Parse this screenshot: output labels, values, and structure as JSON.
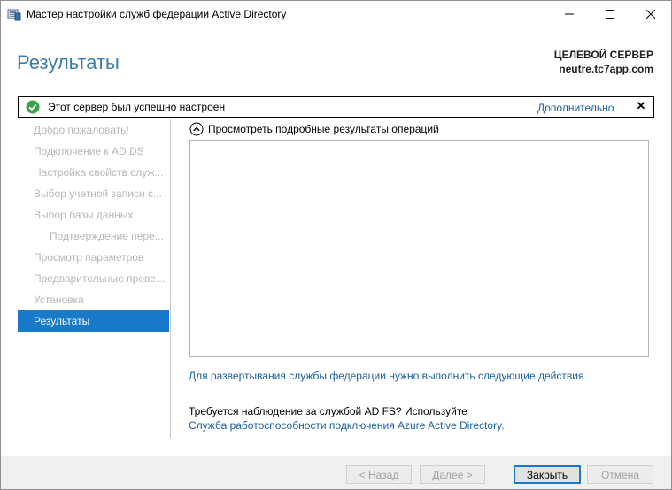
{
  "window": {
    "title": "Мастер настройки служб федерации Active Directory",
    "controls": {
      "minimize_icon": "minimize-icon",
      "maximize_icon": "maximize-icon",
      "close_icon": "close-icon"
    }
  },
  "header": {
    "page_title": "Результаты",
    "target_label": "ЦЕЛЕВОЙ СЕРВЕР",
    "target_name": "neutre.tc7app.com"
  },
  "notification": {
    "text": "Этот сервер был успешно настроен",
    "more_link": "Дополнительно",
    "close_glyph": "✕",
    "status_color": "#3aa14a"
  },
  "sidebar": {
    "items": [
      {
        "label": "Добро пожаловать!"
      },
      {
        "label": "Подключение к AD DS"
      },
      {
        "label": "Настройка свойств служ..."
      },
      {
        "label": "Выбор учетной записи с..."
      },
      {
        "label": "Выбор базы данных"
      },
      {
        "label": "Подтверждение пере..."
      },
      {
        "label": "Просмотр параметров"
      },
      {
        "label": "Предварительные прове..."
      },
      {
        "label": "Установка"
      },
      {
        "label": "Результаты"
      }
    ],
    "active_color": "#1979ca"
  },
  "main": {
    "details_toggle": "Просмотреть подробные результаты операций",
    "deploy_link": "Для развертывания службы федерации нужно выполнить следующие действия",
    "monitor_text": "Требуется наблюдение за службой AD FS? Используйте",
    "health_link": "Служба работоспособности подключения Azure Active Directory."
  },
  "footer": {
    "back": "< Назад",
    "next": "Далее >",
    "close": "Закрыть",
    "cancel": "Отмена"
  }
}
